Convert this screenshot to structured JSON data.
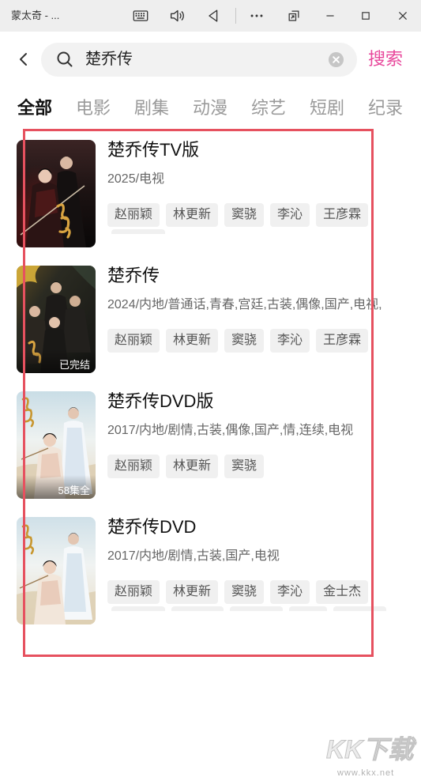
{
  "window": {
    "title": "蒙太奇 - ...",
    "controls": [
      "keyboard-icon",
      "volume-icon",
      "back-triangle-icon",
      "more-icon",
      "pip-icon",
      "minimize-icon",
      "maximize-icon",
      "close-icon"
    ]
  },
  "search": {
    "back_icon": "chevron-left-icon",
    "search_icon": "search-icon",
    "query": "楚乔传",
    "clear_icon": "clear-circle-icon",
    "submit_label": "搜索"
  },
  "tabs": [
    {
      "label": "全部",
      "active": true
    },
    {
      "label": "电影",
      "active": false
    },
    {
      "label": "剧集",
      "active": false
    },
    {
      "label": "动漫",
      "active": false
    },
    {
      "label": "综艺",
      "active": false
    },
    {
      "label": "短剧",
      "active": false
    },
    {
      "label": "纪录",
      "active": false
    }
  ],
  "results": [
    {
      "title": "楚乔传TV版",
      "meta": "2025/电视",
      "cast": [
        "赵丽颖",
        "林更新",
        "窦骁",
        "李沁",
        "王彦霖"
      ]
    },
    {
      "title": "楚乔传",
      "meta": "2024/内地/普通话,青春,宫廷,古装,偶像,国产,电视,",
      "badge": "已完结",
      "cast": [
        "赵丽颖",
        "林更新",
        "窦骁",
        "李沁",
        "王彦霖"
      ]
    },
    {
      "title": "楚乔传DVD版",
      "meta": "2017/内地/剧情,古装,偶像,国产,情,连续,电视",
      "badge": "58集全",
      "cast": [
        "赵丽颖",
        "林更新",
        "窦骁"
      ]
    },
    {
      "title": "楚乔传DVD",
      "meta": "2017/内地/剧情,古装,国产,电视",
      "cast": [
        "赵丽颖",
        "林更新",
        "窦骁",
        "李沁",
        "金士杰"
      ]
    }
  ],
  "watermark": {
    "logo": "KK下载",
    "url": "www.kkx.net"
  },
  "colors": {
    "accent": "#e8479b",
    "highlight_box": "#e6515f",
    "active_tab": "#111111",
    "inactive_tab": "#9a9a9a",
    "tag_background": "#f0f0f0",
    "title_bar": "#eeeeee"
  }
}
